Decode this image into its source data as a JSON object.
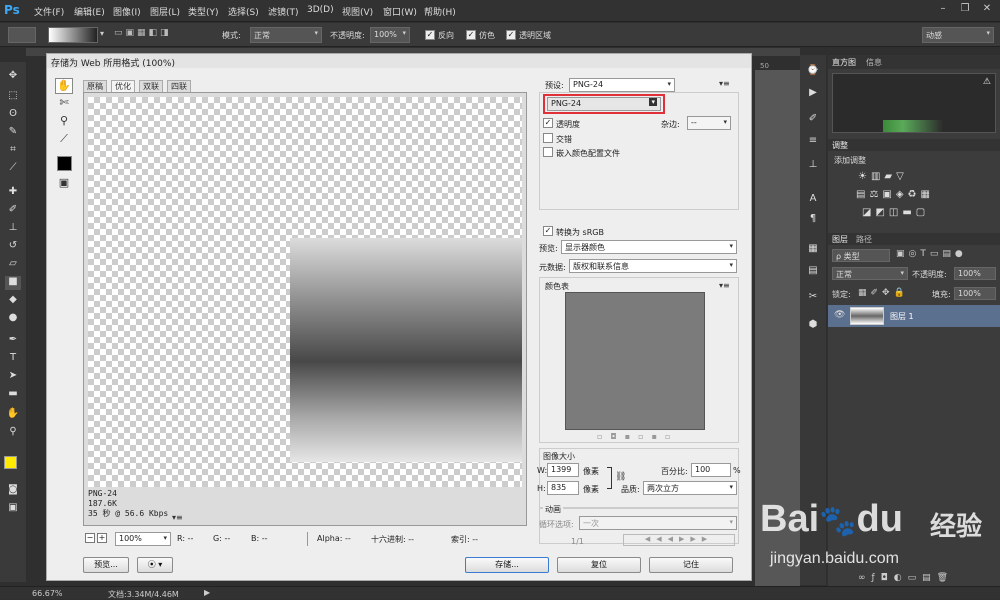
{
  "app": {
    "logo": "Ps"
  },
  "menu": [
    "文件(F)",
    "编辑(E)",
    "图像(I)",
    "图层(L)",
    "类型(Y)",
    "选择(S)",
    "滤镜(T)",
    "3D(D)",
    "视图(V)",
    "窗口(W)",
    "帮助(H)"
  ],
  "options_bar": {
    "mode_label": "模式:",
    "mode_value": "正常",
    "opacity_label": "不透明度:",
    "opacity_value": "100%",
    "reverse_label": "反向",
    "dither_label": "仿色",
    "transparency_label": "透明区域",
    "workspace": "动感"
  },
  "ruler_mark": "50",
  "status": {
    "zoom": "66.67%",
    "doc": "文档:3.34M/4.46M"
  },
  "panels": {
    "histogram_tab": "直方图",
    "info_tab": "信息",
    "adjust_tab": "调整",
    "add_adjust": "添加调整",
    "layers_tab": "图层",
    "paths_tab": "路径",
    "kind_filter": "ρ 类型",
    "blend_mode": "正常",
    "opacity_label": "不透明度:",
    "opacity_value": "100%",
    "lock_label": "锁定:",
    "fill_label": "填充:",
    "fill_value": "100%",
    "layer_name": "图层 1"
  },
  "dialog": {
    "title": "存储为 Web 所用格式 (100%)",
    "tabs": [
      "原稿",
      "优化",
      "双联",
      "四联"
    ],
    "preview_info": [
      "PNG-24",
      "187.6K",
      "35 秒 @ 56.6 Kbps"
    ],
    "bottom": {
      "zoom": "100%",
      "r": "R: --",
      "g": "G: --",
      "b": "B: --",
      "alpha": "Alpha: --",
      "hex": "十六进制: --",
      "index": "索引: --"
    },
    "preset_label": "预设:",
    "preset_value": "PNG-24",
    "format_value": "PNG-24",
    "transparency_label": "透明度",
    "matte_label": "杂边:",
    "matte_value": "--",
    "interlaced_label": "交错",
    "embed_profile_label": "嵌入颜色配置文件",
    "convert_srgb_label": "转换为 sRGB",
    "preview_label": "预览:",
    "preview_value": "显示器颜色",
    "metadata_label": "元数据:",
    "metadata_value": "版权和联系信息",
    "color_table_label": "颜色表",
    "image_size_label": "图像大小",
    "w_label": "W:",
    "w_value": "1399",
    "h_label": "H:",
    "h_value": "835",
    "px_unit": "像素",
    "percent_label": "百分比:",
    "percent_value": "100",
    "percent_unit": "%",
    "quality_label": "品质:",
    "quality_value": "两次立方",
    "animation_label": "动画",
    "loop_label": "循环选项:",
    "loop_value": "一次",
    "frame_counter": "1/1",
    "buttons": {
      "preview": "预览...",
      "save": "存储...",
      "reset": "复位",
      "remember": "记住"
    }
  },
  "watermark": {
    "brand": "Bai",
    "brand2": "du",
    "cn": "经验",
    "url": "jingyan.baidu.com"
  }
}
